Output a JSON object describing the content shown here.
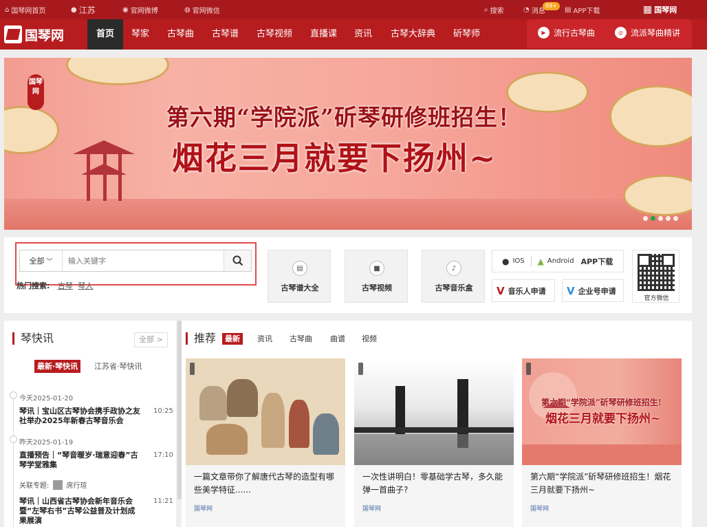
{
  "topbar": {
    "home": "国琴网首页",
    "location": "江苏",
    "weibo": "官网微博",
    "wechat": "官网微信",
    "search": "搜索",
    "messages": "消息",
    "msg_badge": "99+",
    "app": "APP下载",
    "brand": "国琴网"
  },
  "nav": {
    "logo": "国琴网",
    "items": [
      "首页",
      "琴家",
      "古琴曲",
      "古琴谱",
      "古琴视频",
      "直播课",
      "资讯",
      "古琴大辞典",
      "斫琴师"
    ],
    "right": [
      "流行古琴曲",
      "流派琴曲精讲"
    ]
  },
  "banner": {
    "seal": "国琴网",
    "line1": "第六期“学院派”斫琴研修班招生！",
    "line2": "烟花三月就要下扬州~"
  },
  "search": {
    "category": "全部",
    "placeholder": "输入关键字",
    "hot_label": "热门搜索:",
    "hot": [
      "古琴",
      "琴人"
    ]
  },
  "tiles": [
    "古琴谱大全",
    "古琴视频",
    "古琴音乐盒"
  ],
  "app": {
    "ios": "IOS",
    "android": "Android",
    "download": "APP下载",
    "musician": "音乐人申请",
    "enterprise": "企业号申请",
    "qr": "官方微信"
  },
  "news": {
    "title": "琴快讯",
    "more": "全部 >",
    "tabs": [
      "最新·琴快讯",
      "江苏省·琴快讯"
    ],
    "days": [
      "今天2025-01-20",
      "昨天2025-01-19"
    ],
    "items": [
      {
        "title": "琴讯｜宝山区古琴协会携手政协之友社举办2025年新春古琴音乐会",
        "time": "10:25"
      },
      {
        "title": "直播预告｜“琴音暖岁·瑞意迎春”古琴学堂雅集",
        "time": "17:10"
      },
      {
        "title": "琴讯｜山西省古琴协会新年音乐会暨“左琴右书”古琴公益普及计划成果展演",
        "time": "11:21"
      }
    ],
    "topic_label": "关联专题:",
    "topic_name": "席行瑄"
  },
  "recommend": {
    "title": "推荐",
    "tabs": [
      "最新",
      "资讯",
      "古琴曲",
      "曲谱",
      "视频"
    ],
    "cards": [
      {
        "title": "一篇文章带你了解唐代古琴的造型有哪些美学特征......",
        "source": "国琴网"
      },
      {
        "title": "一次性讲明白！零基础学古琴，多久能弹一首曲子?",
        "source": "国琴网"
      },
      {
        "title": "第六期“学院派”斫琴研修班招生！烟花三月就要下扬州~",
        "source": "国琴网"
      }
    ],
    "card3_img": {
      "line1": "第六期“学院派”斫琴研修班招生!",
      "line2": "烟花三月就要下扬州~"
    }
  },
  "colors": {
    "brand": "#b71c1f",
    "accent": "#a8191d"
  }
}
